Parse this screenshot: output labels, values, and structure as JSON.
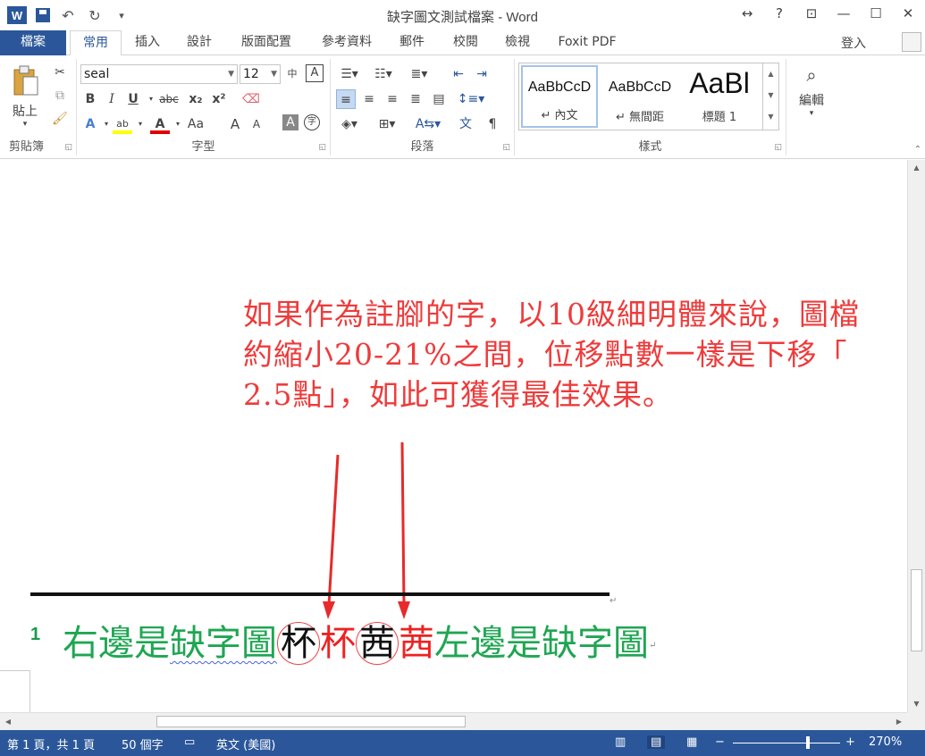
{
  "window": {
    "title": "缺字圖文測試檔案 - Word",
    "app_icon_label": "W",
    "controls": [
      "↔",
      "?",
      "⊡",
      "—",
      "☐",
      "✕"
    ]
  },
  "qat": {
    "save_icon": "save-icon",
    "undo": "↶",
    "redo": "↻",
    "customize": "▾"
  },
  "tabs": [
    "檔案",
    "常用",
    "插入",
    "設計",
    "版面配置",
    "參考資料",
    "郵件",
    "校閱",
    "檢視",
    "Foxit PDF"
  ],
  "active_tab": "常用",
  "signin": "登入",
  "ribbon": {
    "clipboard": {
      "label": "剪貼簿",
      "paste": "貼上"
    },
    "font": {
      "label": "字型",
      "font_name": "seal",
      "font_size": "12",
      "bold": "B",
      "italic": "I",
      "underline": "U",
      "strike": "abc",
      "subscript": "x₂",
      "superscript": "x²",
      "grow": "A",
      "shrink": "A",
      "case": "Aa"
    },
    "paragraph": {
      "label": "段落"
    },
    "styles": {
      "label": "樣式",
      "items": [
        {
          "sample": "AaBbCcD",
          "name": "↵ 內文"
        },
        {
          "sample": "AaBbCcD",
          "name": "↵ 無間距"
        },
        {
          "sample": "AaBl",
          "name": "標題 1"
        }
      ]
    },
    "editing": {
      "label": "編輯"
    }
  },
  "document": {
    "annotation_lines": [
      "如果作為註腳的字，以10級細明體來說，圖檔",
      "約縮小20-21%之間，位移點數一樣是下移「",
      "2.5點」，如此可獲得最佳效果。"
    ],
    "footnote_number": "1",
    "footnote": {
      "part1": "右邊是",
      "part2": "缺字圖",
      "char1_black": "杯",
      "char1_red": "杯",
      "char2_black": "茜",
      "char2_red": "茜",
      "part3": "左邊是缺字圖"
    },
    "paragraph_mark": "↵"
  },
  "status": {
    "page": "第 1 頁，共 1 頁",
    "words": "50 個字",
    "language": "英文 (美國)",
    "zoom": "270%",
    "zoom_minus": "−",
    "zoom_plus": "+"
  },
  "colors": {
    "accent": "#2b579a",
    "annotation_red": "#ee3b3b",
    "footnote_green": "#1fa652",
    "arrow_red": "#e82a2a"
  }
}
